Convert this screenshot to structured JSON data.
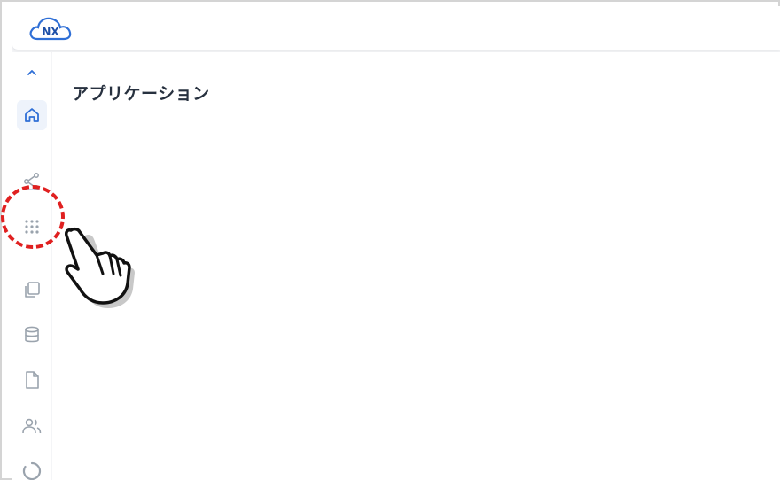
{
  "header": {
    "logo_text": "NX"
  },
  "sidebar": {
    "items": [
      {
        "name": "collapse",
        "icon": "chevron-up-icon"
      },
      {
        "name": "home",
        "icon": "home-icon",
        "active": true
      },
      {
        "name": "share",
        "icon": "share-icon"
      },
      {
        "name": "apps",
        "icon": "grid-icon",
        "highlighted": true
      },
      {
        "name": "copy",
        "icon": "copy-icon"
      },
      {
        "name": "database",
        "icon": "database-icon"
      },
      {
        "name": "document",
        "icon": "document-icon"
      },
      {
        "name": "users",
        "icon": "users-icon"
      },
      {
        "name": "loading",
        "icon": "spinner-icon"
      }
    ]
  },
  "main": {
    "title": "アプリケーション"
  },
  "annotation": {
    "highlight_color": "#e02020",
    "pointer": "hand-pointer-icon"
  },
  "colors": {
    "accent": "#2f6fd6",
    "icon_gray": "#9aa3ad",
    "title_text": "#27313f"
  }
}
